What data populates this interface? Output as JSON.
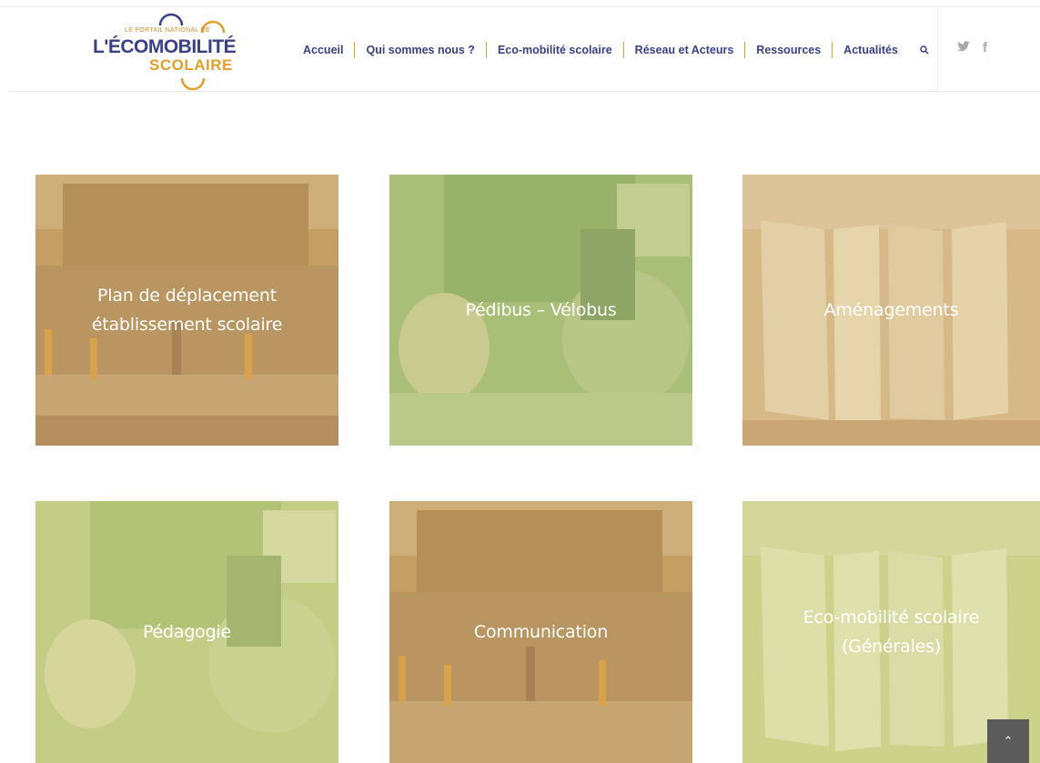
{
  "logo": {
    "small_text": "LE PORTAIL NATIONAL DE",
    "main_text": "L'ÉCOMOBILITÉ",
    "sub_text": "SCOLAIRE"
  },
  "nav": {
    "items": [
      {
        "label": "Accueil"
      },
      {
        "label": "Qui sommes nous ?"
      },
      {
        "label": "Eco-mobilité scolaire"
      },
      {
        "label": "Réseau et Acteurs"
      },
      {
        "label": "Ressources"
      },
      {
        "label": "Actualités"
      }
    ],
    "search_icon": "search-icon"
  },
  "social": {
    "twitter": "🐦",
    "facebook": "f"
  },
  "tiles": [
    {
      "label": "Plan de déplacement établissement scolaire",
      "color": "#c9a86a",
      "scene": "street"
    },
    {
      "label": "Pédibus – Vélobus",
      "color": "#b2c580",
      "scene": "classroom"
    },
    {
      "label": "Aménagements",
      "color": "#d8bb8c",
      "scene": "exhibit"
    },
    {
      "label": "Pédagogie",
      "color": "#c8d28a",
      "scene": "classroom"
    },
    {
      "label": "Communication",
      "color": "#c9a86a",
      "scene": "street"
    },
    {
      "label": "Eco-mobilité scolaire (Générales)",
      "color": "#cfd58e",
      "scene": "exhibit"
    }
  ],
  "scroll_top": {
    "label": "⌃"
  }
}
